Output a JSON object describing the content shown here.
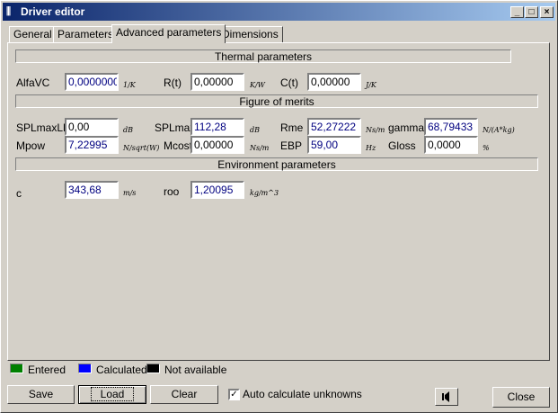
{
  "window": {
    "title": "Driver editor",
    "minimize_icon": "minimize-icon",
    "maximize_icon": "maximize-icon",
    "close_icon": "close-icon"
  },
  "tabs": [
    {
      "label": "General",
      "active": false
    },
    {
      "label": "Parameters",
      "active": false
    },
    {
      "label": "Advanced parameters",
      "active": true
    },
    {
      "label": "Dimensions",
      "active": false
    }
  ],
  "sections": {
    "thermal": "Thermal parameters",
    "figure": "Figure of merits",
    "environment": "Environment parameters"
  },
  "thermal": {
    "alfavc": {
      "label": "AlfaVC",
      "value": "0,0000000",
      "unit": "1/K"
    },
    "rt": {
      "label": "R(t)",
      "value": "0,00000",
      "unit": "K/W"
    },
    "ct": {
      "label": "C(t)",
      "value": "0,00000",
      "unit": "J/K"
    }
  },
  "figure": {
    "splmaxlf": {
      "label": "SPLmaxLF",
      "value": "0,00",
      "unit": "dB"
    },
    "splmax": {
      "label": "SPLmax",
      "value": "112,28",
      "unit": "dB"
    },
    "rme": {
      "label": "Rme",
      "value": "52,27222",
      "unit": "Ns/m"
    },
    "gamma": {
      "label": "gamma",
      "value": "68,79433",
      "unit": "N/(A*kg)"
    },
    "mpow": {
      "label": "Mpow",
      "value": "7,22995",
      "unit": "N/sqrt(W)"
    },
    "mcost": {
      "label": "Mcost",
      "value": "0,00000",
      "unit": "Ns/m"
    },
    "ebp": {
      "label": "EBP",
      "value": "59,00",
      "unit": "Hz"
    },
    "gloss": {
      "label": "Gloss",
      "value": "0,0000",
      "unit": "%"
    }
  },
  "environment": {
    "c": {
      "label": "c",
      "value": "343,68",
      "unit": "m/s"
    },
    "roo": {
      "label": "roo",
      "value": "1,20095",
      "unit": "kg/m^3"
    }
  },
  "legend": {
    "entered": {
      "label": "Entered",
      "color": "#008000"
    },
    "calculated": {
      "label": "Calculated",
      "color": "#0000ff"
    },
    "not_available": {
      "label": "Not available",
      "color": "#000000"
    }
  },
  "buttons": {
    "save": "Save",
    "load": "Load",
    "clear": "Clear",
    "auto_calc": "Auto calculate unknowns",
    "auto_calc_checked": true,
    "close": "Close"
  },
  "colors": {
    "title_start": "#0a246a",
    "title_end": "#a6caf0",
    "face": "#d4d0c8",
    "calculated_text": "#000080"
  }
}
